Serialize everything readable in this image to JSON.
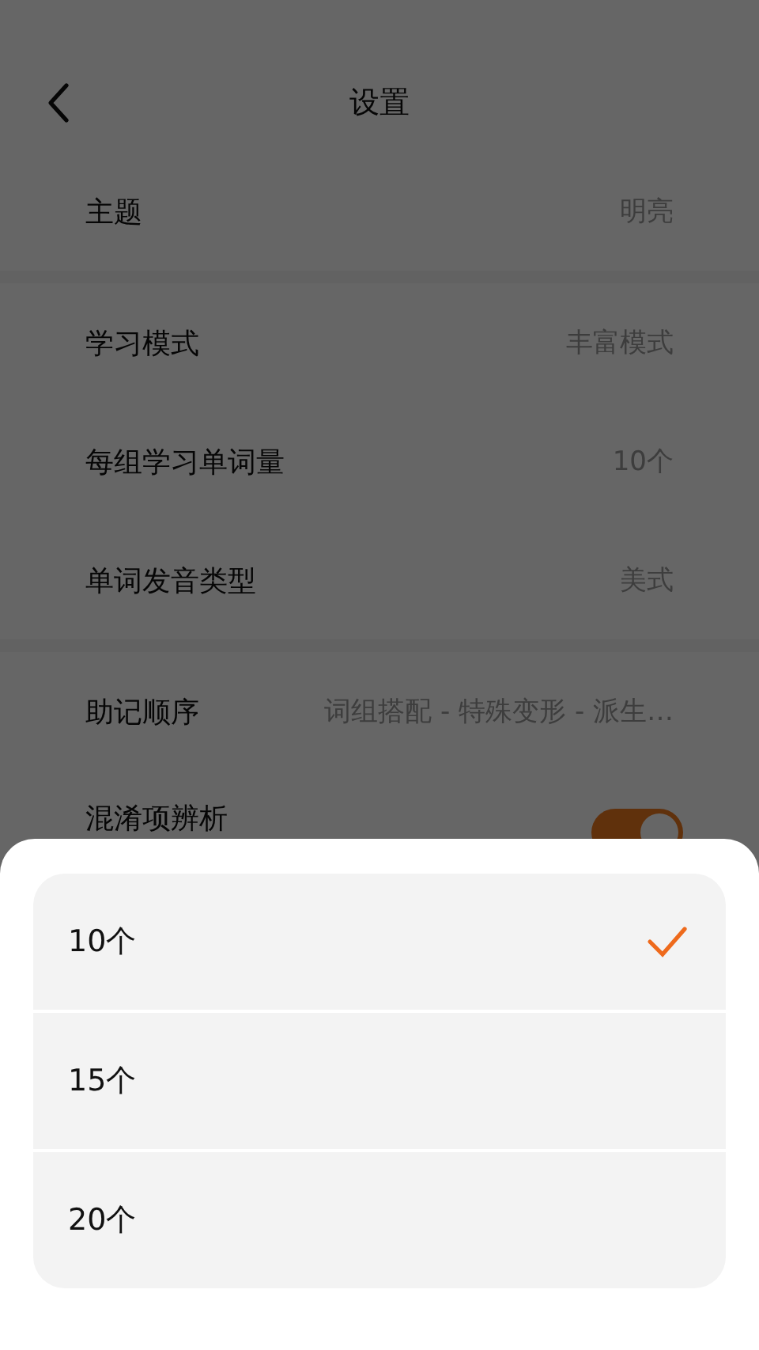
{
  "header": {
    "title": "设置"
  },
  "sections": [
    {
      "rows": [
        {
          "kind": "value",
          "label": "主题",
          "value": "明亮"
        }
      ]
    },
    {
      "rows": [
        {
          "kind": "value",
          "label": "学习模式",
          "value": "丰富模式"
        },
        {
          "kind": "value",
          "label": "每组学习单词量",
          "value": "10个"
        },
        {
          "kind": "value",
          "label": "单词发音类型",
          "value": "美式"
        }
      ]
    },
    {
      "rows": [
        {
          "kind": "value",
          "label": "助记顺序",
          "value": "词组搭配 - 特殊变形 - 派生…"
        },
        {
          "kind": "toggle",
          "label": "混淆项辨析",
          "on": true
        }
      ]
    }
  ],
  "sheet": {
    "options": [
      {
        "label": "10个",
        "selected": true
      },
      {
        "label": "15个",
        "selected": false
      },
      {
        "label": "20个",
        "selected": false
      }
    ]
  }
}
